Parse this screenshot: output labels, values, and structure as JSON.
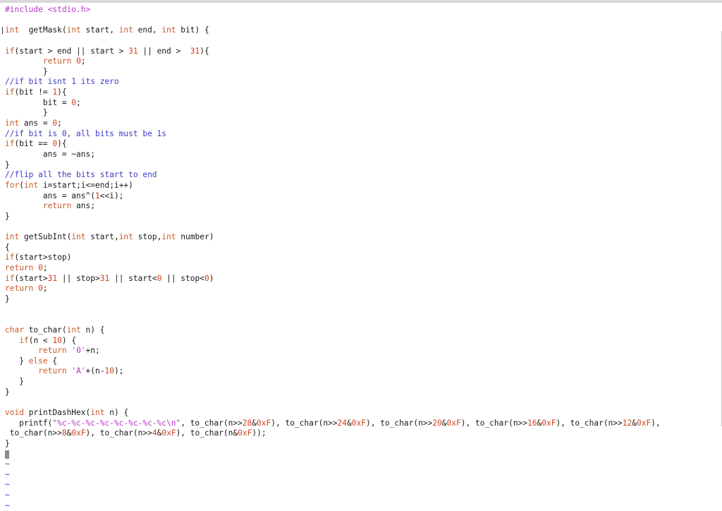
{
  "colors": {
    "keyword": "#c85a28",
    "preprocessor": "#b736c7",
    "comment": "#3c3cc8",
    "number": "#d4421f",
    "string": "#b736c7",
    "text": "#1a1a1a",
    "tilde": "#3c3cc8",
    "cursor": "#8c8c8c"
  },
  "lines": [
    [
      {
        "t": "pp",
        "v": "#include <stdio.h>"
      }
    ],
    [],
    [
      {
        "t": "kw",
        "v": "int"
      },
      {
        "t": "tx",
        "v": "  getMask("
      },
      {
        "t": "kw",
        "v": "int"
      },
      {
        "t": "tx",
        "v": " start, "
      },
      {
        "t": "kw",
        "v": "int"
      },
      {
        "t": "tx",
        "v": " end, "
      },
      {
        "t": "kw",
        "v": "int"
      },
      {
        "t": "tx",
        "v": " bit) {"
      }
    ],
    [],
    [
      {
        "t": "kw",
        "v": "if"
      },
      {
        "t": "tx",
        "v": "(start > end || start > "
      },
      {
        "t": "num",
        "v": "31"
      },
      {
        "t": "tx",
        "v": " || end >  "
      },
      {
        "t": "num",
        "v": "31"
      },
      {
        "t": "tx",
        "v": "){"
      }
    ],
    [
      {
        "t": "tx",
        "v": "        "
      },
      {
        "t": "kw",
        "v": "return"
      },
      {
        "t": "tx",
        "v": " "
      },
      {
        "t": "num",
        "v": "0"
      },
      {
        "t": "tx",
        "v": ";"
      }
    ],
    [
      {
        "t": "tx",
        "v": "        }"
      }
    ],
    [
      {
        "t": "cm",
        "v": "//if bit isnt 1 its zero"
      }
    ],
    [
      {
        "t": "kw",
        "v": "if"
      },
      {
        "t": "tx",
        "v": "(bit != "
      },
      {
        "t": "num",
        "v": "1"
      },
      {
        "t": "tx",
        "v": "){"
      }
    ],
    [
      {
        "t": "tx",
        "v": "        bit = "
      },
      {
        "t": "num",
        "v": "0"
      },
      {
        "t": "tx",
        "v": ";"
      }
    ],
    [
      {
        "t": "tx",
        "v": "        }"
      }
    ],
    [
      {
        "t": "kw",
        "v": "int"
      },
      {
        "t": "tx",
        "v": " ans = "
      },
      {
        "t": "num",
        "v": "0"
      },
      {
        "t": "tx",
        "v": ";"
      }
    ],
    [
      {
        "t": "cm",
        "v": "//if bit is 0, all bits must be 1s"
      }
    ],
    [
      {
        "t": "kw",
        "v": "if"
      },
      {
        "t": "tx",
        "v": "(bit == "
      },
      {
        "t": "num",
        "v": "0"
      },
      {
        "t": "tx",
        "v": "){"
      }
    ],
    [
      {
        "t": "tx",
        "v": "        ans = ~ans;"
      }
    ],
    [
      {
        "t": "tx",
        "v": "}"
      }
    ],
    [
      {
        "t": "cm",
        "v": "//flip all the bits start to end"
      }
    ],
    [
      {
        "t": "kw",
        "v": "for"
      },
      {
        "t": "tx",
        "v": "("
      },
      {
        "t": "kw",
        "v": "int"
      },
      {
        "t": "tx",
        "v": " i=start;i<=end;i++)"
      }
    ],
    [
      {
        "t": "tx",
        "v": "        ans = ans^("
      },
      {
        "t": "num",
        "v": "1"
      },
      {
        "t": "tx",
        "v": "<<i);"
      }
    ],
    [
      {
        "t": "tx",
        "v": "        "
      },
      {
        "t": "kw",
        "v": "return"
      },
      {
        "t": "tx",
        "v": " ans;"
      }
    ],
    [
      {
        "t": "tx",
        "v": "}"
      }
    ],
    [],
    [
      {
        "t": "kw",
        "v": "int"
      },
      {
        "t": "tx",
        "v": " getSubInt("
      },
      {
        "t": "kw",
        "v": "int"
      },
      {
        "t": "tx",
        "v": " start,"
      },
      {
        "t": "kw",
        "v": "int"
      },
      {
        "t": "tx",
        "v": " stop,"
      },
      {
        "t": "kw",
        "v": "int"
      },
      {
        "t": "tx",
        "v": " number)"
      }
    ],
    [
      {
        "t": "tx",
        "v": "{"
      }
    ],
    [
      {
        "t": "kw",
        "v": "if"
      },
      {
        "t": "tx",
        "v": "(start>stop)"
      }
    ],
    [
      {
        "t": "kw",
        "v": "return"
      },
      {
        "t": "tx",
        "v": " "
      },
      {
        "t": "num",
        "v": "0"
      },
      {
        "t": "tx",
        "v": ";"
      }
    ],
    [
      {
        "t": "kw",
        "v": "if"
      },
      {
        "t": "tx",
        "v": "(start>"
      },
      {
        "t": "num",
        "v": "31"
      },
      {
        "t": "tx",
        "v": " || stop>"
      },
      {
        "t": "num",
        "v": "31"
      },
      {
        "t": "tx",
        "v": " || start<"
      },
      {
        "t": "num",
        "v": "0"
      },
      {
        "t": "tx",
        "v": " || stop<"
      },
      {
        "t": "num",
        "v": "0"
      },
      {
        "t": "tx",
        "v": ")"
      }
    ],
    [
      {
        "t": "kw",
        "v": "return"
      },
      {
        "t": "tx",
        "v": " "
      },
      {
        "t": "num",
        "v": "0"
      },
      {
        "t": "tx",
        "v": ";"
      }
    ],
    [
      {
        "t": "tx",
        "v": "}"
      }
    ],
    [],
    [],
    [
      {
        "t": "kw",
        "v": "char"
      },
      {
        "t": "tx",
        "v": " to_char("
      },
      {
        "t": "kw",
        "v": "int"
      },
      {
        "t": "tx",
        "v": " n) {"
      }
    ],
    [
      {
        "t": "tx",
        "v": "   "
      },
      {
        "t": "kw",
        "v": "if"
      },
      {
        "t": "tx",
        "v": "(n < "
      },
      {
        "t": "num",
        "v": "10"
      },
      {
        "t": "tx",
        "v": ") {"
      }
    ],
    [
      {
        "t": "tx",
        "v": "       "
      },
      {
        "t": "kw",
        "v": "return"
      },
      {
        "t": "tx",
        "v": " "
      },
      {
        "t": "str",
        "v": "'0'"
      },
      {
        "t": "tx",
        "v": "+n;"
      }
    ],
    [
      {
        "t": "tx",
        "v": "   } "
      },
      {
        "t": "kw",
        "v": "else"
      },
      {
        "t": "tx",
        "v": " {"
      }
    ],
    [
      {
        "t": "tx",
        "v": "       "
      },
      {
        "t": "kw",
        "v": "return"
      },
      {
        "t": "tx",
        "v": " "
      },
      {
        "t": "str",
        "v": "'A'"
      },
      {
        "t": "tx",
        "v": "+(n-"
      },
      {
        "t": "num",
        "v": "10"
      },
      {
        "t": "tx",
        "v": ");"
      }
    ],
    [
      {
        "t": "tx",
        "v": "   }"
      }
    ],
    [
      {
        "t": "tx",
        "v": "}"
      }
    ],
    [],
    [
      {
        "t": "kw",
        "v": "void"
      },
      {
        "t": "tx",
        "v": " printDashHex("
      },
      {
        "t": "kw",
        "v": "int"
      },
      {
        "t": "tx",
        "v": " n) {"
      }
    ],
    [
      {
        "t": "tx",
        "v": "   printf("
      },
      {
        "t": "str",
        "v": "\"%c-%c-%c-%c-%c-%c-%c-%c\\n\""
      },
      {
        "t": "tx",
        "v": ", to_char(n>>"
      },
      {
        "t": "num",
        "v": "28"
      },
      {
        "t": "tx",
        "v": "&"
      },
      {
        "t": "num",
        "v": "0xF"
      },
      {
        "t": "tx",
        "v": "), to_char(n>>"
      },
      {
        "t": "num",
        "v": "24"
      },
      {
        "t": "tx",
        "v": "&"
      },
      {
        "t": "num",
        "v": "0xF"
      },
      {
        "t": "tx",
        "v": "), to_char(n>>"
      },
      {
        "t": "num",
        "v": "20"
      },
      {
        "t": "tx",
        "v": "&"
      },
      {
        "t": "num",
        "v": "0xF"
      },
      {
        "t": "tx",
        "v": "), to_char(n>>"
      },
      {
        "t": "num",
        "v": "16"
      },
      {
        "t": "tx",
        "v": "&"
      },
      {
        "t": "num",
        "v": "0xF"
      },
      {
        "t": "tx",
        "v": "), to_char(n>>"
      },
      {
        "t": "num",
        "v": "12"
      },
      {
        "t": "tx",
        "v": "&"
      },
      {
        "t": "num",
        "v": "0xF"
      },
      {
        "t": "tx",
        "v": "),"
      }
    ],
    [
      {
        "t": "tx",
        "v": " to_char(n>>"
      },
      {
        "t": "num",
        "v": "8"
      },
      {
        "t": "tx",
        "v": "&"
      },
      {
        "t": "num",
        "v": "0xF"
      },
      {
        "t": "tx",
        "v": "), to_char(n>>"
      },
      {
        "t": "num",
        "v": "4"
      },
      {
        "t": "tx",
        "v": "&"
      },
      {
        "t": "num",
        "v": "0xF"
      },
      {
        "t": "tx",
        "v": "), to_char(n&"
      },
      {
        "t": "num",
        "v": "0xF"
      },
      {
        "t": "tx",
        "v": "));"
      }
    ],
    [
      {
        "t": "tx",
        "v": "}"
      }
    ],
    [
      {
        "t": "cursor",
        "v": ""
      }
    ],
    [
      {
        "t": "tilde",
        "v": "~"
      }
    ],
    [
      {
        "t": "tilde",
        "v": "~"
      }
    ],
    [
      {
        "t": "tilde",
        "v": "~"
      }
    ],
    [
      {
        "t": "tilde",
        "v": "~"
      }
    ],
    [
      {
        "t": "tilde",
        "v": "~"
      }
    ]
  ]
}
